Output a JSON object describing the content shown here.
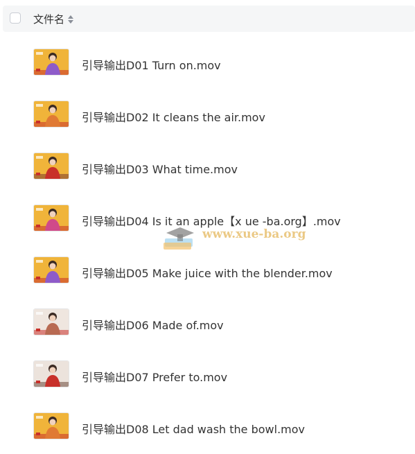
{
  "header": {
    "column_title": "文件名"
  },
  "files": [
    {
      "name": "引导输出D01 Turn on.mov",
      "thumb_variant": "yellow-purple"
    },
    {
      "name": "引导输出D02 It cleans the air.mov",
      "thumb_variant": "yellow"
    },
    {
      "name": "引导输出D03 What time.mov",
      "thumb_variant": "yellow-red"
    },
    {
      "name": "引导输出D04 Is it an apple【x ue -ba.org】.mov",
      "thumb_variant": "yellow-play"
    },
    {
      "name": "引导输出D05 Make juice with the blender.mov",
      "thumb_variant": "yellow-purple"
    },
    {
      "name": "引导输出D06 Made of.mov",
      "thumb_variant": "light"
    },
    {
      "name": "引导输出D07 Prefer to.mov",
      "thumb_variant": "light-red"
    },
    {
      "name": "引导输出D08 Let dad wash the bowl.mov",
      "thumb_variant": "yellow"
    }
  ],
  "watermark": {
    "text": "www.xue-ba.org"
  },
  "colors": {
    "header_bg": "#f5f6f7",
    "text": "#333333",
    "thumb_yellow": "#f0b43a",
    "thumb_red": "#c8302a"
  }
}
